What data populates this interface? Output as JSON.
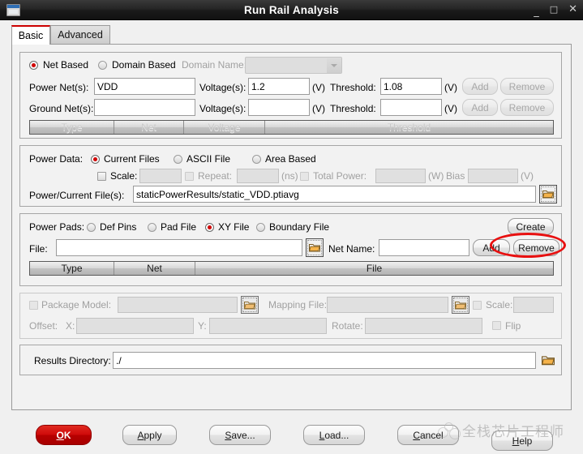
{
  "window": {
    "title": "Run Rail Analysis",
    "icon": "window-icon",
    "controls": {
      "minimize": "_",
      "maximize": "□",
      "close": "✕"
    }
  },
  "tabs": [
    {
      "label": "Basic",
      "active": true
    },
    {
      "label": "Advanced",
      "active": false
    }
  ],
  "net_section": {
    "net_based_label": "Net Based",
    "domain_based_label": "Domain Based",
    "domain_name_label": "Domain Name:",
    "domain_name_value": "",
    "selected_mode": "Net Based",
    "power_nets_label": "Power Net(s):",
    "power_nets_value": "VDD",
    "power_voltage_label": "Voltage(s):",
    "power_voltage_value": "1.2",
    "power_voltage_unit": "(V)",
    "power_threshold_label": "Threshold:",
    "power_threshold_value": "1.08",
    "power_threshold_unit": "(V)",
    "ground_nets_label": "Ground Net(s):",
    "ground_nets_value": "",
    "ground_voltage_label": "Voltage(s):",
    "ground_voltage_value": "",
    "ground_voltage_unit": "(V)",
    "ground_threshold_label": "Threshold:",
    "ground_threshold_value": "",
    "ground_threshold_unit": "(V)",
    "add_label": "Add",
    "remove_label": "Remove",
    "table_headers": [
      "Type",
      "Net",
      "Voltage",
      "Threshold"
    ],
    "table_rows": []
  },
  "power_data_section": {
    "title": "Power Data:",
    "options": [
      "Current Files",
      "ASCII File",
      "Area Based"
    ],
    "selected_option": "Current Files",
    "scale_label": "Scale:",
    "scale_value": "",
    "scale_checked": false,
    "repeat_label": "Repeat:",
    "repeat_value": "",
    "repeat_checked": false,
    "repeat_unit": "(ns)",
    "total_power_label": "Total Power:",
    "total_power_value": "",
    "total_power_checked": false,
    "total_power_unit": "(W)",
    "bias_label": "Bias",
    "bias_value": "",
    "bias_unit": "(V)",
    "file_label": "Power/Current File(s):",
    "file_value": "staticPowerResults/static_VDD.ptiavg",
    "browse_icon": "folder-icon"
  },
  "power_pads_section": {
    "title": "Power Pads:",
    "options": [
      "Def Pins",
      "Pad File",
      "XY File",
      "Boundary File"
    ],
    "selected_option": "XY File",
    "create_label": "Create",
    "file_label": "File:",
    "file_value": "",
    "browse_icon": "folder-icon",
    "net_name_label": "Net Name:",
    "net_name_value": "",
    "add_label": "Add",
    "remove_label": "Remove",
    "table_headers": [
      "Type",
      "Net",
      "File"
    ],
    "table_rows": []
  },
  "package_section": {
    "package_model_label": "Package Model:",
    "package_model_value": "",
    "package_model_checked": false,
    "mapping_file_label": "Mapping File:",
    "mapping_file_value": "",
    "scale_label": "Scale:",
    "scale_value": "",
    "scale_checked": false,
    "offset_label": "Offset:",
    "offset_x_label": "X:",
    "offset_x_value": "",
    "offset_y_label": "Y:",
    "offset_y_value": "",
    "rotate_label": "Rotate:",
    "rotate_value": "",
    "flip_label": "Flip",
    "flip_checked": false,
    "browse_icon": "folder-icon"
  },
  "results_section": {
    "label": "Results Directory:",
    "value": "./",
    "browse_icon": "folder-icon"
  },
  "footer_buttons": [
    {
      "name": "ok",
      "label": "OK",
      "primary": true
    },
    {
      "name": "apply",
      "label": "Apply",
      "primary": false
    },
    {
      "name": "save",
      "label": "Save...",
      "primary": false
    },
    {
      "name": "load",
      "label": "Load...",
      "primary": false
    },
    {
      "name": "cancel",
      "label": "Cancel",
      "primary": false
    },
    {
      "name": "help",
      "label": "Help",
      "primary": false
    }
  ],
  "annotation": {
    "shape": "ellipse",
    "color": "#e81010",
    "target": "Create"
  },
  "watermark": {
    "text": "全栈芯片工程师"
  }
}
